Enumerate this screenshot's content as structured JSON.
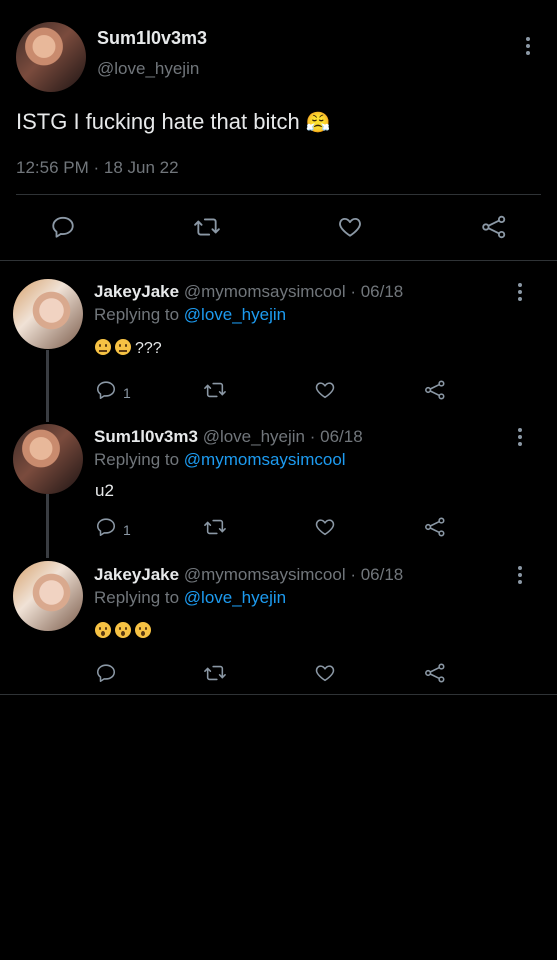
{
  "main_tweet": {
    "display_name": "Sum1l0v3m3",
    "handle": "@love_hyejin",
    "text": "ISTG I fucking hate that bitch",
    "emoji": "😤",
    "timestamp": "12:56 PM · 18 Jun 22"
  },
  "replies": [
    {
      "display_name": "JakeyJake",
      "handle_date": "@mymomsaysimcool · 06/18",
      "replying_prefix": "Replying to ",
      "replying_to": "@love_hyejin",
      "text": "???",
      "reply_count": "1"
    },
    {
      "display_name": "Sum1l0v3m3",
      "handle_date": "@love_hyejin · 06/18",
      "replying_prefix": "Replying to ",
      "replying_to": "@mymomsaysimcool",
      "text": "u2",
      "reply_count": "1"
    },
    {
      "display_name": "JakeyJake",
      "handle_date": "@mymomsaysimcool · 06/18",
      "replying_prefix": "Replying to ",
      "replying_to": "@love_hyejin",
      "text": "",
      "reply_count": ""
    }
  ],
  "colors": {
    "background": "#000000",
    "text": "#e7e9ea",
    "muted": "#71767b",
    "link": "#1d9bf0",
    "divider": "#2f3336"
  },
  "icons": [
    "more-icon",
    "reply-icon",
    "retweet-icon",
    "like-icon",
    "share-icon"
  ]
}
